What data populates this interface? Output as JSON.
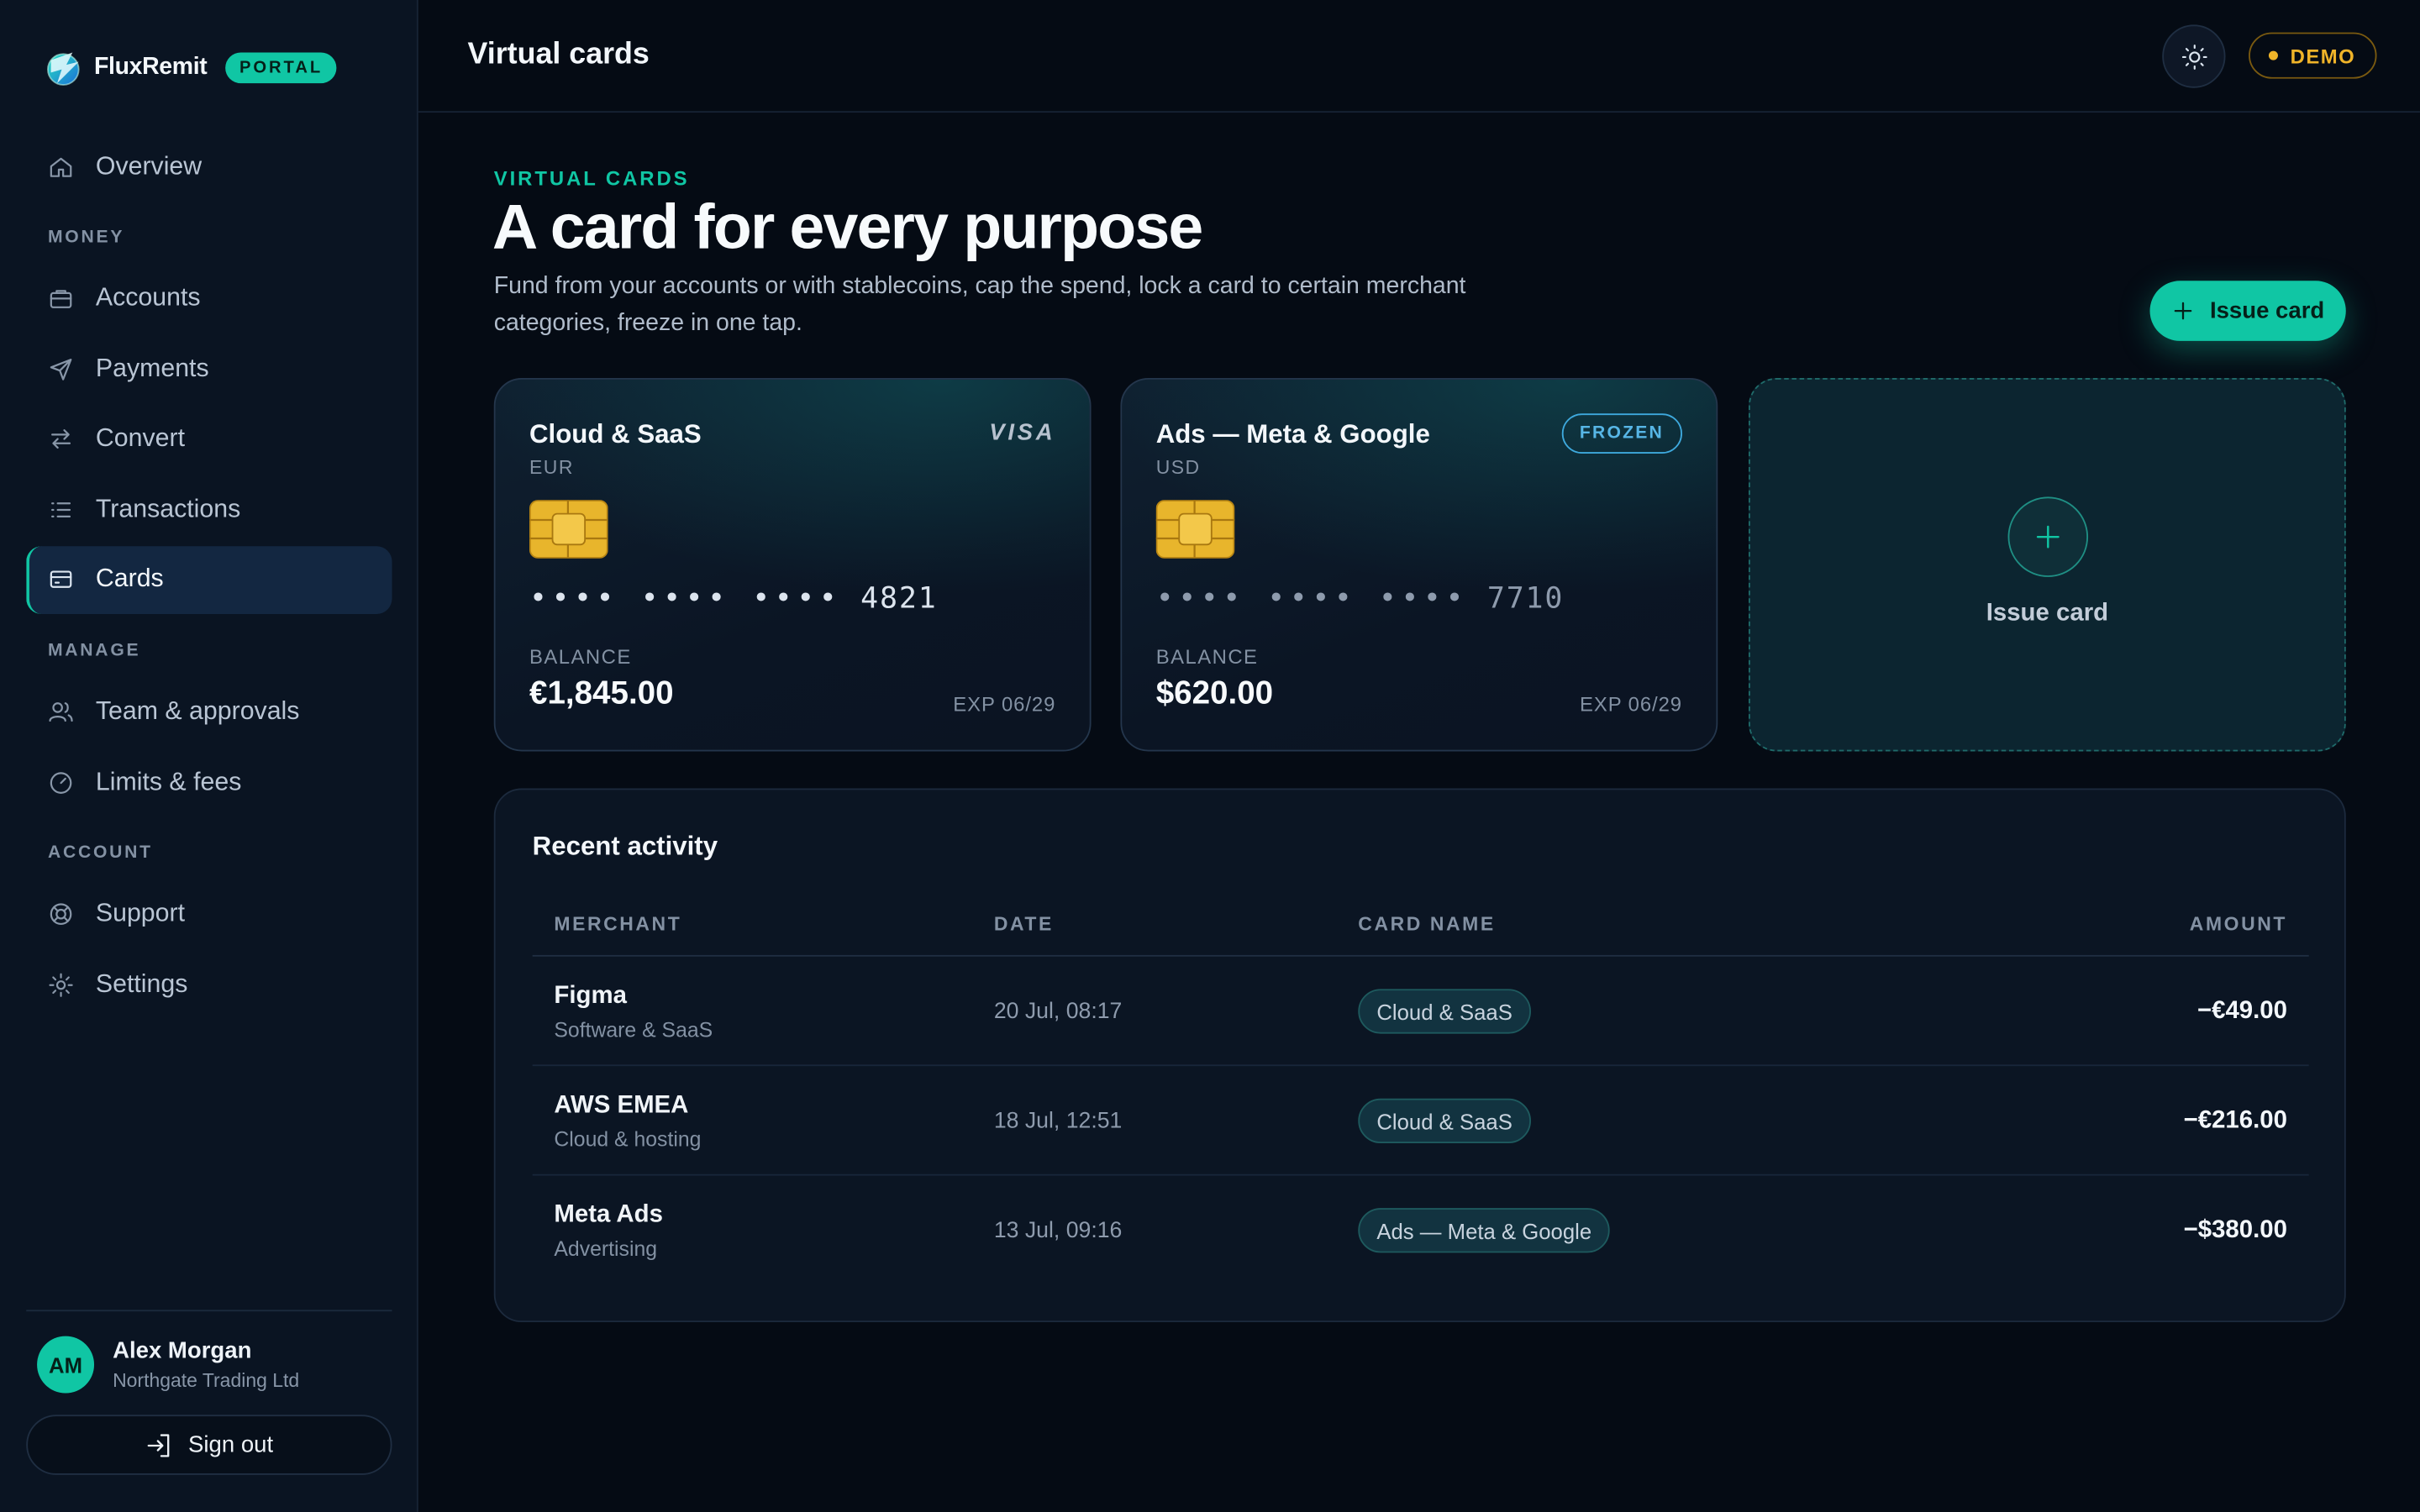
{
  "brand": {
    "name": "FluxRemit",
    "badge": "PORTAL"
  },
  "sidebar": {
    "overview": "Overview",
    "money_label": "MONEY",
    "accounts": "Accounts",
    "payments": "Payments",
    "convert": "Convert",
    "transactions": "Transactions",
    "cards": "Cards",
    "manage_label": "MANAGE",
    "team": "Team & approvals",
    "limits": "Limits & fees",
    "account_label": "ACCOUNT",
    "support": "Support",
    "settings": "Settings",
    "active_item": "Cards"
  },
  "user": {
    "initials": "AM",
    "name": "Alex Morgan",
    "org": "Northgate Trading Ltd",
    "signout": "Sign out"
  },
  "topbar": {
    "title": "Virtual cards",
    "demo": "DEMO",
    "theme_icon": "sun-icon"
  },
  "hero": {
    "eyebrow": "VIRTUAL CARDS",
    "headline": "A card for every purpose",
    "subtitle": "Fund from your accounts or with stablecoins, cap the spend, lock a card to certain merchant categories, freeze in one tap.",
    "issue_button": "Issue card"
  },
  "cards": [
    {
      "name": "Cloud & SaaS",
      "currency": "EUR",
      "network": "VISA",
      "masked": "•••• •••• ••••",
      "last4": "4821",
      "balance_label": "BALANCE",
      "balance": "€1,845.00",
      "expiry": "EXP 06/29",
      "status": ""
    },
    {
      "name": "Ads — Meta & Google",
      "currency": "USD",
      "network": "",
      "masked": "•••• •••• ••••",
      "last4": "7710",
      "balance_label": "BALANCE",
      "balance": "$620.00",
      "expiry": "EXP 06/29",
      "status": "FROZEN"
    }
  ],
  "issue_tile": {
    "label": "Issue card"
  },
  "activity": {
    "title": "Recent activity",
    "columns": [
      "MERCHANT",
      "DATE",
      "CARD NAME",
      "AMOUNT"
    ],
    "rows": [
      {
        "merchant": "Figma",
        "category": "Software & SaaS",
        "date": "20 Jul, 08:17",
        "card": "Cloud & SaaS",
        "amount": "−€49.00"
      },
      {
        "merchant": "AWS EMEA",
        "category": "Cloud & hosting",
        "date": "18 Jul, 12:51",
        "card": "Cloud & SaaS",
        "amount": "−€216.00"
      },
      {
        "merchant": "Meta Ads",
        "category": "Advertising",
        "date": "13 Jul, 09:16",
        "card": "Ads — Meta & Google",
        "amount": "−$380.00"
      }
    ]
  },
  "colors": {
    "accent": "#10c6a4",
    "background": "#050b14",
    "frozen": "#57b6e6",
    "demo": "#f0b429"
  }
}
